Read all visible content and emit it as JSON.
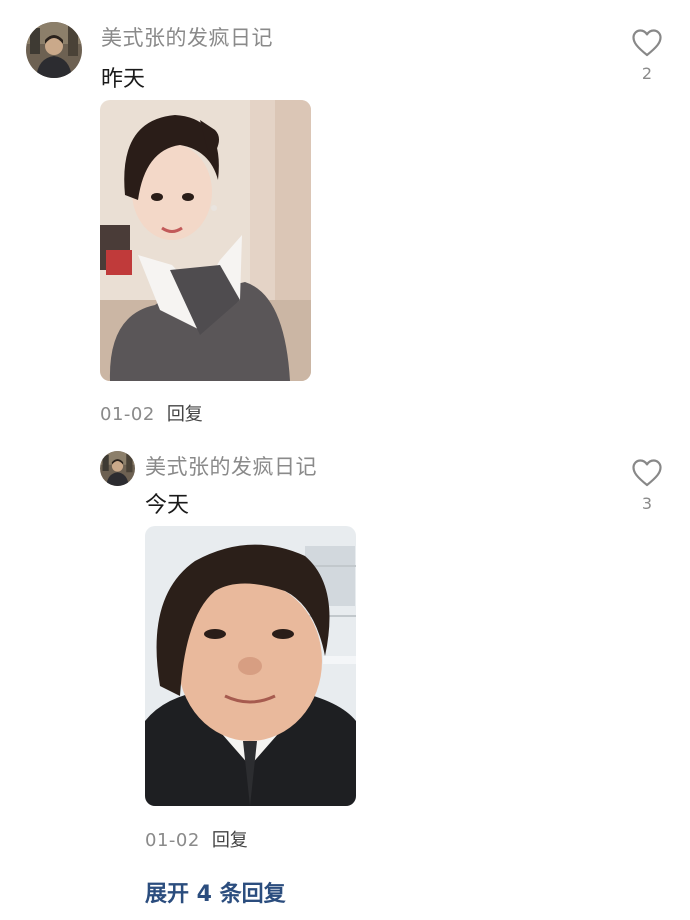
{
  "comments": [
    {
      "username": "美式张的发疯日记",
      "text": "昨天",
      "date": "01-02",
      "reply_label": "回复",
      "likes": "2",
      "avatar_icon": "user-avatar",
      "image_icon": "photo-selfie"
    }
  ],
  "replies": [
    {
      "username": "美式张的发疯日记",
      "text": "今天",
      "date": "01-02",
      "reply_label": "回复",
      "likes": "3",
      "avatar_icon": "user-avatar",
      "image_icon": "photo-selfie"
    }
  ],
  "expand_label": "展开 4 条回复",
  "colors": {
    "username": "#8a8a8a",
    "text": "#1a1a1a",
    "link": "#2b4d7e",
    "icon": "#888888"
  }
}
